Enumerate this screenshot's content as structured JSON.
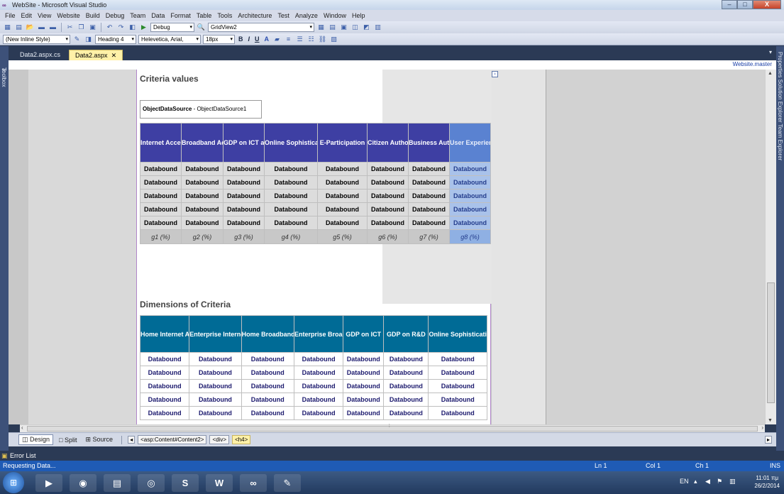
{
  "window": {
    "title": "WebSite - Microsoft Visual Studio",
    "min_glyph": "–",
    "max_glyph": "□",
    "close_glyph": "X"
  },
  "menu": [
    "File",
    "Edit",
    "View",
    "Website",
    "Build",
    "Debug",
    "Team",
    "Data",
    "Format",
    "Table",
    "Tools",
    "Architecture",
    "Test",
    "Analyze",
    "Window",
    "Help"
  ],
  "toolbar1": {
    "config": "Debug",
    "target": "GridView2"
  },
  "toolbar2": {
    "style": "(New Inline Style)",
    "block": "Heading 4",
    "font": "Helevetica, Arial,",
    "size": "18px",
    "bold": "B",
    "italic": "I",
    "underline": "U",
    "fontcolor": "A"
  },
  "tabs": [
    {
      "label": "Data2.aspx.cs",
      "active": false
    },
    {
      "label": "Data2.aspx",
      "active": true,
      "close": "✕"
    }
  ],
  "toolbox_label": "Toolbox",
  "right_panels_label": "Properties  Solution Explorer  Team Explorer",
  "master_page": "Website.master",
  "criteria": {
    "title": "Criteria values",
    "datasource_type": "ObjectDataSource",
    "datasource_name": " - ObjectDataSource1",
    "headers": [
      "Internet Access",
      "Broadband Access",
      "GDP on ICT and R&D",
      "Online Sophistication",
      "E-Participation",
      "Citizen Authority Interaction",
      "Business Authority Interaction",
      "User Experience"
    ],
    "rows": [
      [
        "Databound",
        "Databound",
        "Databound",
        "Databound",
        "Databound",
        "Databound",
        "Databound",
        "Databound"
      ],
      [
        "Databound",
        "Databound",
        "Databound",
        "Databound",
        "Databound",
        "Databound",
        "Databound",
        "Databound"
      ],
      [
        "Databound",
        "Databound",
        "Databound",
        "Databound",
        "Databound",
        "Databound",
        "Databound",
        "Databound"
      ],
      [
        "Databound",
        "Databound",
        "Databound",
        "Databound",
        "Databound",
        "Databound",
        "Databound",
        "Databound"
      ],
      [
        "Databound",
        "Databound",
        "Databound",
        "Databound",
        "Databound",
        "Databound",
        "Databound",
        "Databound"
      ]
    ],
    "footer": [
      "g1 (%)",
      "g2 (%)",
      "g3 (%)",
      "g4 (%)",
      "g5 (%)",
      "g6 (%)",
      "g7 (%)",
      "g8 (%)"
    ]
  },
  "dimensions": {
    "title": "Dimensions of Criteria",
    "headers": [
      "Home Internet Access",
      "Enterprise Internet Access",
      "Home Broadband Access",
      "Enterprise Broadband Access",
      "GDP on ICT",
      "GDP on R&D",
      "Online Sophistication"
    ],
    "rows": [
      [
        "Databound",
        "Databound",
        "Databound",
        "Databound",
        "Databound",
        "Databound",
        "Databound"
      ],
      [
        "Databound",
        "Databound",
        "Databound",
        "Databound",
        "Databound",
        "Databound",
        "Databound"
      ],
      [
        "Databound",
        "Databound",
        "Databound",
        "Databound",
        "Databound",
        "Databound",
        "Databound"
      ],
      [
        "Databound",
        "Databound",
        "Databound",
        "Databound",
        "Databound",
        "Databound",
        "Databound"
      ],
      [
        "Databound",
        "Databound",
        "Databound",
        "Databound",
        "Databound",
        "Databound",
        "Databound"
      ]
    ]
  },
  "viewbar": {
    "design": "Design",
    "split": "Split",
    "source": "Source",
    "crumbs": [
      "<asp:Content#Content2>",
      "<div>",
      "<h4>"
    ]
  },
  "errorlist": "Error List",
  "status": {
    "message": "Requesting Data...",
    "ln": "Ln 1",
    "col": "Col 1",
    "ch": "Ch 1",
    "mode": "INS"
  },
  "taskbar": {
    "apps": [
      "start-orb",
      "media-player",
      "firefox",
      "explorer",
      "chrome",
      "skype",
      "word",
      "visual-studio",
      "paint"
    ],
    "lang": "EN",
    "time": "11:01 πμ",
    "date": "26/2/2014"
  }
}
